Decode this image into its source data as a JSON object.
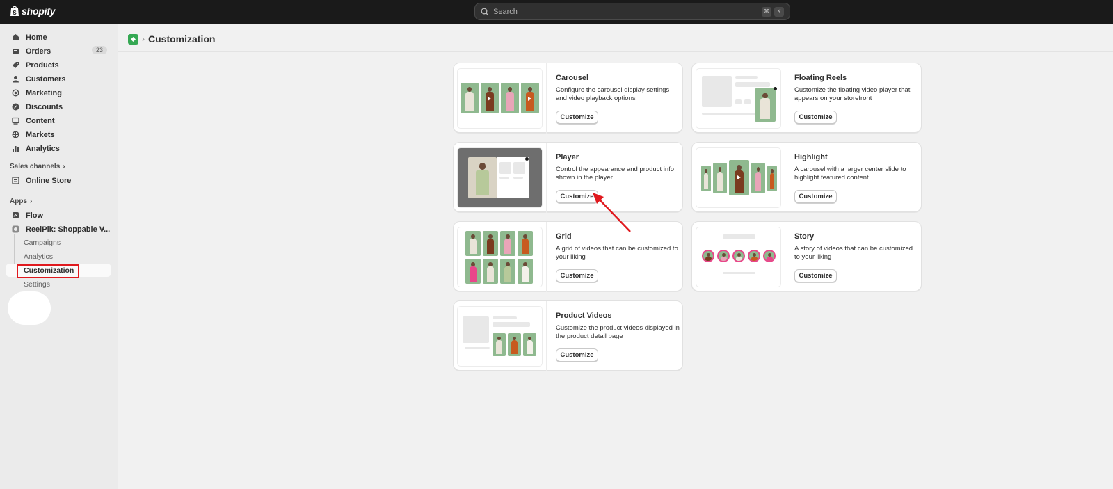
{
  "topbar": {
    "brand": "shopify",
    "search_placeholder": "Search",
    "shortcut_cmd": "⌘",
    "shortcut_key": "K"
  },
  "sidebar": {
    "items": [
      {
        "label": "Home",
        "icon": "home-icon"
      },
      {
        "label": "Orders",
        "icon": "orders-icon",
        "badge": "23"
      },
      {
        "label": "Products",
        "icon": "tag-icon"
      },
      {
        "label": "Customers",
        "icon": "person-icon"
      },
      {
        "label": "Marketing",
        "icon": "target-icon"
      },
      {
        "label": "Discounts",
        "icon": "discount-icon"
      },
      {
        "label": "Content",
        "icon": "content-icon"
      },
      {
        "label": "Markets",
        "icon": "globe-icon"
      },
      {
        "label": "Analytics",
        "icon": "bar-chart-icon"
      }
    ],
    "sales_channels_label": "Sales channels",
    "online_store_label": "Online Store",
    "apps_label": "Apps",
    "flow_label": "Flow",
    "app_name": "ReelPik: Shoppable V...",
    "app_subitems": [
      "Campaigns",
      "Analytics",
      "Customization",
      "Settings"
    ]
  },
  "header": {
    "crumb_separator": "›",
    "title": "Customization"
  },
  "cards": [
    {
      "title": "Carousel",
      "desc": "Configure the carousel display settings and video playback options",
      "button": "Customize"
    },
    {
      "title": "Floating Reels",
      "desc": "Customize the floating video player that appears on your storefront",
      "button": "Customize"
    },
    {
      "title": "Player",
      "desc": "Control the appearance and product info shown in the player",
      "button": "Customize"
    },
    {
      "title": "Highlight",
      "desc": "A carousel with a larger center slide to highlight featured content",
      "button": "Customize"
    },
    {
      "title": "Grid",
      "desc": "A grid of videos that can be customized to your liking",
      "button": "Customize"
    },
    {
      "title": "Story",
      "desc": "A story of videos that can be customized to your liking",
      "button": "Customize"
    },
    {
      "title": "Product Videos",
      "desc": "Customize the product videos displayed in the product detail page",
      "button": "Customize"
    }
  ],
  "colors": {
    "topbar_bg": "#1a1a1a",
    "annotation_red": "#e0191e",
    "app_icon_green": "#35a853"
  }
}
